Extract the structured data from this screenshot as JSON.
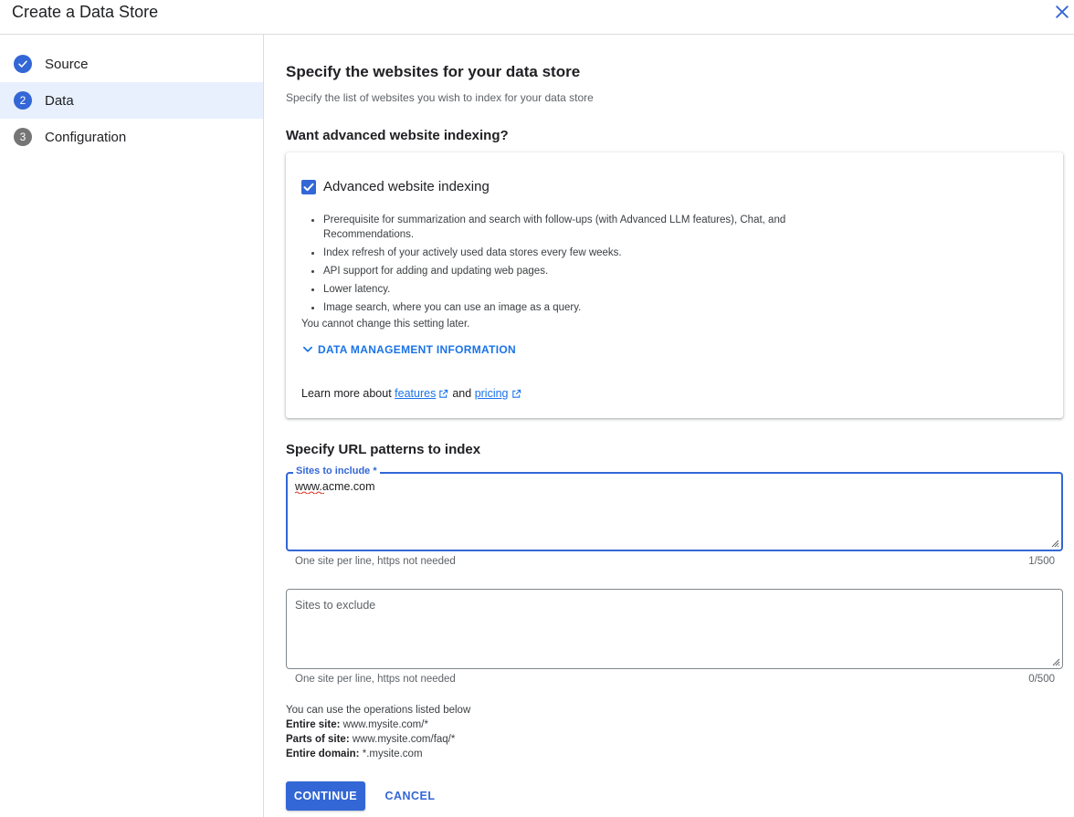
{
  "header": {
    "title": "Create a Data Store",
    "close_icon": "close-icon"
  },
  "stepper": {
    "steps": [
      {
        "label": "Source",
        "badge": "",
        "state": "done"
      },
      {
        "label": "Data",
        "badge": "2",
        "state": "current"
      },
      {
        "label": "Configuration",
        "badge": "3",
        "state": "todo"
      }
    ]
  },
  "main": {
    "title": "Specify the websites for your data store",
    "subtitle": "Specify the list of websites you wish to index for your data store",
    "advanced_heading": "Want advanced website indexing?",
    "advanced": {
      "checkbox_label": "Advanced website indexing",
      "checked": true,
      "bullets": [
        "Prerequisite for summarization and search with follow-ups (with Advanced LLM features), Chat, and Recommendations.",
        "Index refresh of your actively used data stores every few weeks.",
        "API support for adding and updating web pages.",
        "Lower latency.",
        "Image search, where you can use an image as a query."
      ],
      "note": "You cannot change this setting later.",
      "data_management_label": "DATA MANAGEMENT INFORMATION",
      "learn_more_prefix": "Learn more about",
      "features_link": "features",
      "and_text": "and",
      "pricing_link": "pricing"
    },
    "url_heading": "Specify URL patterns to index",
    "include": {
      "label": "Sites to include *",
      "value": "www.acme.com",
      "hint": "One site per line, https not needed",
      "count": "1/500"
    },
    "exclude": {
      "placeholder": "Sites to exclude",
      "value": "",
      "hint": "One site per line, https not needed",
      "count": "0/500"
    },
    "operations": {
      "intro": "You can use the operations listed below",
      "entire_site_label": "Entire site:",
      "entire_site_value": "www.mysite.com/*",
      "parts_label": "Parts of site:",
      "parts_value": "www.mysite.com/faq/*",
      "domain_label": "Entire domain:",
      "domain_value": "*.mysite.com"
    },
    "buttons": {
      "continue": "CONTINUE",
      "cancel": "CANCEL"
    }
  },
  "colors": {
    "accent": "#3367d6",
    "link": "#1a73e8",
    "active_step_bg": "#e8f0fe",
    "inactive_badge": "#757575"
  }
}
